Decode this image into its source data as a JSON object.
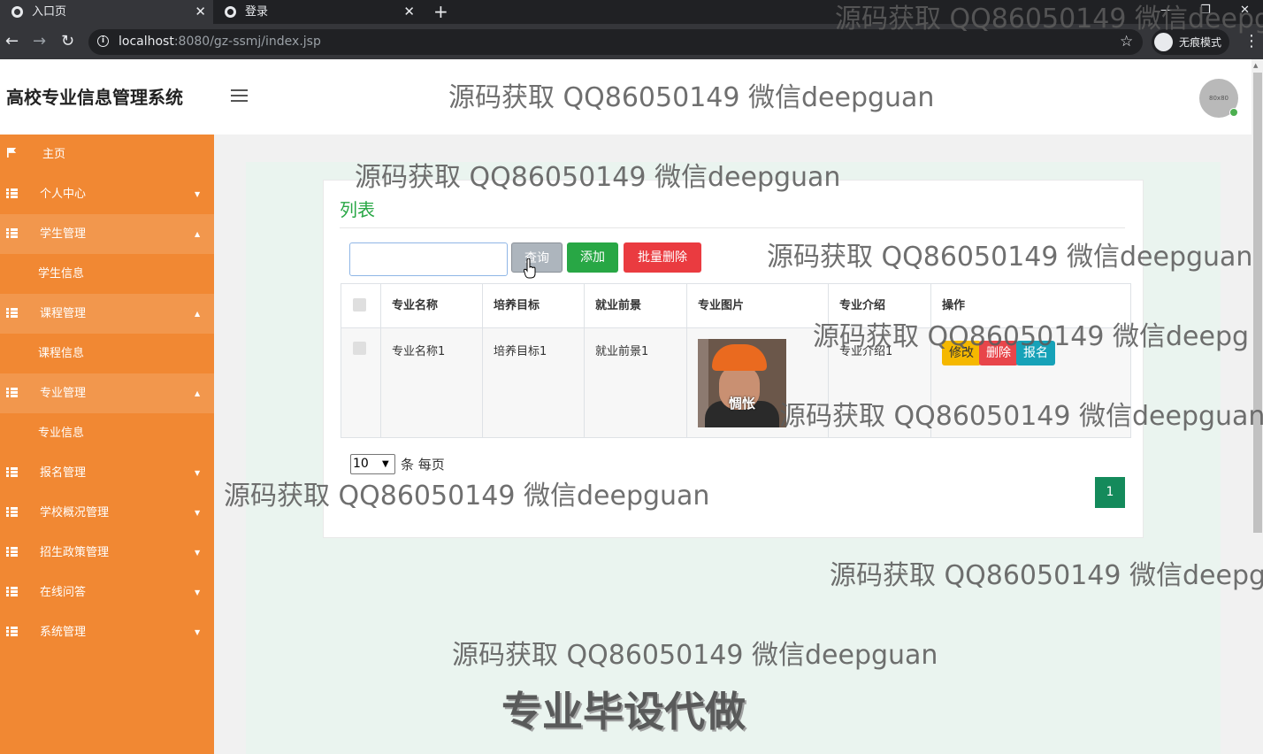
{
  "browser": {
    "tabs": [
      {
        "label": "入口页",
        "active": true
      },
      {
        "label": "登录",
        "active": false
      }
    ],
    "new_tab": "+",
    "url_host": "localhost",
    "url_path": ":8080/gz-ssmj/index.jsp",
    "incognito_label": "无痕模式"
  },
  "header": {
    "title": "高校专业信息管理系统",
    "avatar_text": "80x80"
  },
  "sidebar": {
    "items": [
      {
        "label": "主页",
        "icon": "flag-icon"
      },
      {
        "label": "个人中心",
        "icon": "grid-icon",
        "caret": "▼"
      },
      {
        "label": "学生管理",
        "icon": "grid-icon",
        "caret": "▲"
      },
      {
        "label": "学生信息"
      },
      {
        "label": "课程管理",
        "icon": "grid-icon",
        "caret": "▲"
      },
      {
        "label": "课程信息"
      },
      {
        "label": "专业管理",
        "icon": "grid-icon",
        "caret": "▲"
      },
      {
        "label": "专业信息"
      },
      {
        "label": "报名管理",
        "icon": "grid-icon",
        "caret": "▼"
      },
      {
        "label": "学校概况管理",
        "icon": "grid-icon",
        "caret": "▼"
      },
      {
        "label": "招生政策管理",
        "icon": "grid-icon",
        "caret": "▼"
      },
      {
        "label": "在线问答",
        "icon": "grid-icon",
        "caret": "▼"
      },
      {
        "label": "系统管理",
        "icon": "grid-icon",
        "caret": "▼"
      }
    ]
  },
  "main": {
    "card_title": "列表",
    "search_value": "",
    "buttons": {
      "query": "查询",
      "add": "添加",
      "batch_delete": "批量删除"
    },
    "table": {
      "columns": [
        "专业名称",
        "培养目标",
        "就业前景",
        "专业图片",
        "专业介绍",
        "操作"
      ],
      "rows": [
        {
          "name": "专业名称1",
          "goal": "培养目标1",
          "prospect": "就业前景1",
          "image_caption": "惆怅",
          "intro": "专业介绍1",
          "actions": [
            "修改",
            "删除",
            "报名"
          ]
        }
      ]
    },
    "pagination": {
      "page_size": "10",
      "suffix": "条 每页",
      "current_page": "1"
    }
  },
  "watermarks": {
    "text": "源码获取 QQ86050149 微信deepguan",
    "top_right_text": "源码获取 QQ86050149 微信deepg",
    "right_cut_text": "源码获取 QQ86050149 微信deepgu",
    "big_text": "专业毕设代做"
  },
  "colors": {
    "sidebar": "#f18833",
    "accent_green": "#28a745",
    "danger": "#ea3b40",
    "page_active": "#148a5b"
  }
}
